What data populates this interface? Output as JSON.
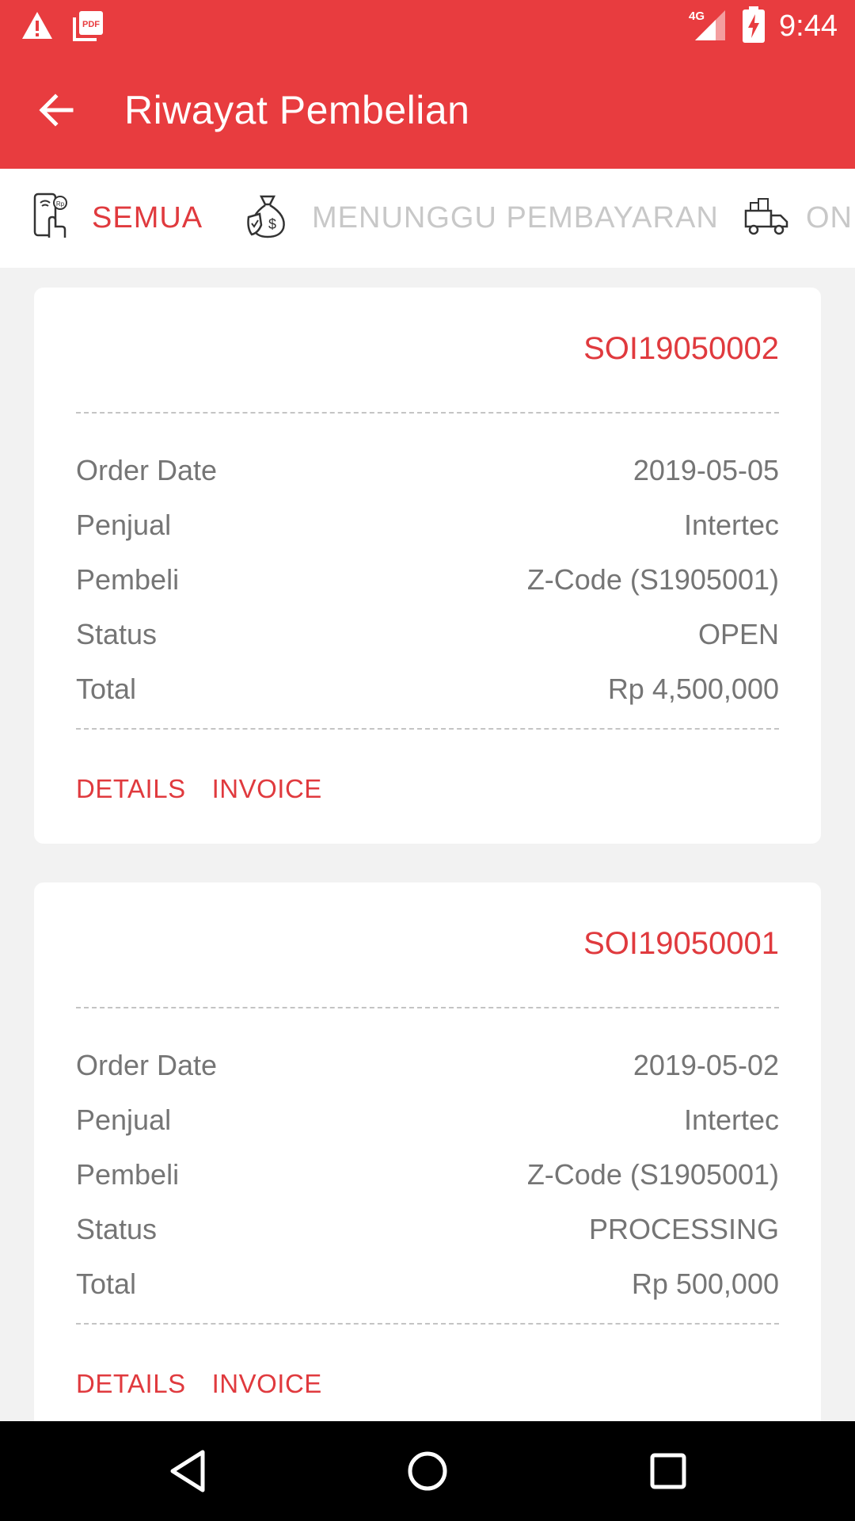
{
  "status_bar": {
    "time": "9:44",
    "network": "4G",
    "icons": [
      "warning-icon",
      "pdf-icon",
      "signal-icon",
      "battery-charging-icon"
    ],
    "pdf_label": "PDF"
  },
  "app_bar": {
    "title": "Riwayat Pembelian",
    "back_icon": "arrow-back-icon"
  },
  "tabs": [
    {
      "label": "SEMUA",
      "icon": "phone-payment-icon",
      "active": true
    },
    {
      "label": "MENUNGGU PEMBAYARAN",
      "icon": "money-bag-icon",
      "active": false
    },
    {
      "label": "ON",
      "icon": "delivery-truck-icon",
      "active": false
    }
  ],
  "orders": [
    {
      "order_no": "SOI19050002",
      "rows": [
        {
          "label": "Order Date",
          "value": "2019-05-05"
        },
        {
          "label": "Penjual",
          "value": "Intertec"
        },
        {
          "label": "Pembeli",
          "value": "Z-Code (S1905001)"
        },
        {
          "label": "Status",
          "value": "OPEN"
        },
        {
          "label": "Total",
          "value": "Rp 4,500,000"
        }
      ],
      "actions": {
        "details": "DETAILS",
        "invoice": "INVOICE"
      }
    },
    {
      "order_no": "SOI19050001",
      "rows": [
        {
          "label": "Order Date",
          "value": "2019-05-02"
        },
        {
          "label": "Penjual",
          "value": "Intertec"
        },
        {
          "label": "Pembeli",
          "value": "Z-Code (S1905001)"
        },
        {
          "label": "Status",
          "value": "PROCESSING"
        },
        {
          "label": "Total",
          "value": "Rp 500,000"
        }
      ],
      "actions": {
        "details": "DETAILS",
        "invoice": "INVOICE"
      }
    }
  ],
  "nav_bar": {
    "icons": [
      "back-triangle-icon",
      "home-circle-icon",
      "recents-square-icon"
    ]
  },
  "colors": {
    "primary": "#e83c3f",
    "accent_text": "#e03a3e",
    "inactive_tab": "#c8c8c8",
    "body_text": "#757575",
    "background": "#f2f2f2"
  }
}
